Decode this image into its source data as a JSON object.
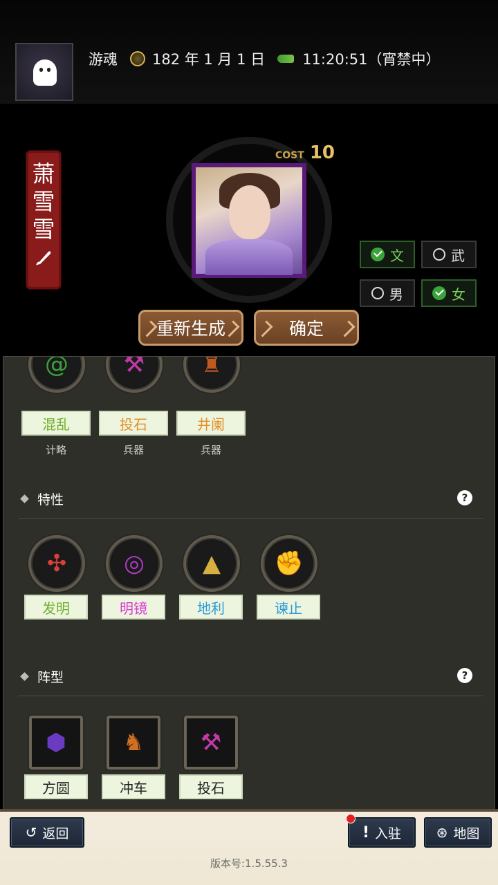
{
  "header": {
    "role": "游魂",
    "date": "182 年 1 月 1 日",
    "time": "11:20:51（宵禁中）"
  },
  "hero": {
    "name_chars": [
      "萧",
      "雪",
      "雪"
    ],
    "cost_label": "COST",
    "cost_value": "10",
    "toggles": {
      "wen": "文",
      "wu": "武",
      "male": "男",
      "female": "女"
    },
    "regenerate_label": "重新生成",
    "confirm_label": "确定"
  },
  "skills": [
    {
      "name": "混乱",
      "type": "计略",
      "color": "#6fb02a",
      "icon": "swirl-icon"
    },
    {
      "name": "投石",
      "type": "兵器",
      "color": "#e2902a",
      "icon": "catapult-icon"
    },
    {
      "name": "井阑",
      "type": "兵器",
      "color": "#e2902a",
      "icon": "siege-tower-icon"
    }
  ],
  "traits": {
    "title": "特性",
    "items": [
      {
        "name": "发明",
        "color": "#6fb02a",
        "icon": "windmill-icon"
      },
      {
        "name": "明镜",
        "color": "#d63bd0",
        "icon": "mirror-icon"
      },
      {
        "name": "地利",
        "color": "#2a9ad6",
        "icon": "terrain-icon"
      },
      {
        "name": "谏止",
        "color": "#2a9ad6",
        "icon": "fist-icon"
      }
    ]
  },
  "formation": {
    "title": "阵型",
    "items": [
      {
        "name": "方圆",
        "icon": "turtle-shell-icon"
      },
      {
        "name": "冲车",
        "icon": "battering-horse-icon"
      },
      {
        "name": "投石",
        "icon": "catapult-icon"
      }
    ]
  },
  "footer": {
    "back_label": "返回",
    "station_label": "入驻",
    "map_label": "地图",
    "version": "版本号:1.5.55.3"
  }
}
